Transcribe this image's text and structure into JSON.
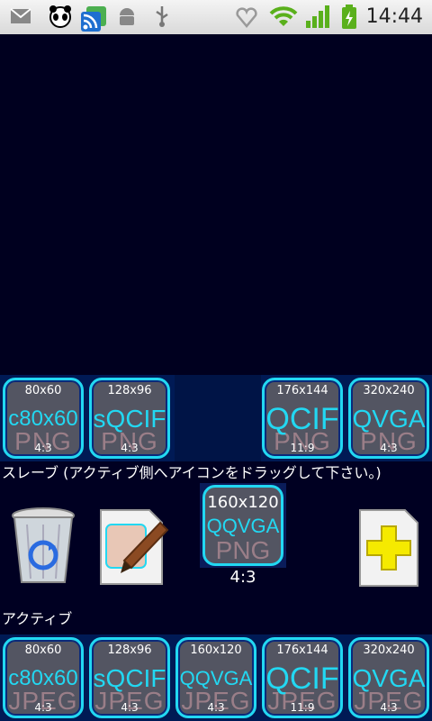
{
  "status": {
    "time": "14:44"
  },
  "labels": {
    "slave": "スレーブ (アクティブ側へアイコンをドラッグして下さい。)",
    "active": "アクティブ"
  },
  "slave_tiles": [
    {
      "res": "80x60",
      "name": "c80x60",
      "fmt": "PNG",
      "ratio": "4:3"
    },
    {
      "res": "128x96",
      "name": "sQCIF",
      "fmt": "PNG",
      "ratio": "4:3"
    },
    {
      "res": "176x144",
      "name": "QCIF",
      "fmt": "PNG",
      "ratio": "11:9"
    },
    {
      "res": "320x240",
      "name": "QVGA",
      "fmt": "PNG",
      "ratio": "4:3"
    }
  ],
  "middle_tile": {
    "res": "160x120",
    "name": "QQVGA",
    "fmt": "PNG",
    "ratio": "4:3"
  },
  "active_tiles": [
    {
      "res": "80x60",
      "name": "c80x60",
      "fmt": "JPEG",
      "ratio": "4:3"
    },
    {
      "res": "128x96",
      "name": "sQCIF",
      "fmt": "JPEG",
      "ratio": "4:3"
    },
    {
      "res": "160x120",
      "name": "QQVGA",
      "fmt": "JPEG",
      "ratio": "4:3"
    },
    {
      "res": "176x144",
      "name": "QCIF",
      "fmt": "JPEG",
      "ratio": "11:9"
    },
    {
      "res": "320x240",
      "name": "QVGA",
      "fmt": "JPEG",
      "ratio": "4:3"
    }
  ]
}
